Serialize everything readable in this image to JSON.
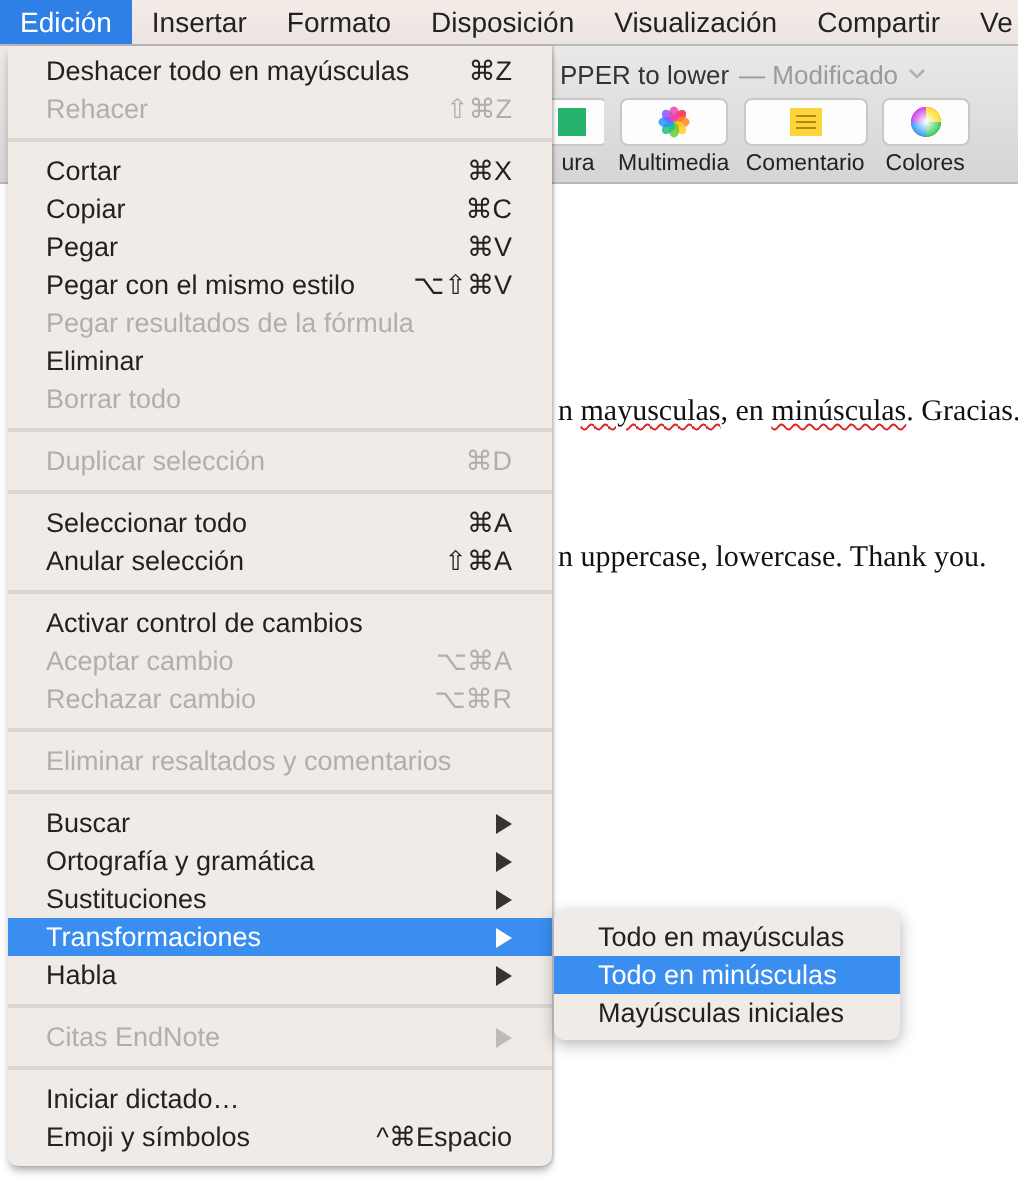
{
  "menubar": [
    {
      "label": "Edición",
      "selected": true
    },
    {
      "label": "Insertar",
      "selected": false
    },
    {
      "label": "Formato",
      "selected": false
    },
    {
      "label": "Disposición",
      "selected": false
    },
    {
      "label": "Visualización",
      "selected": false
    },
    {
      "label": "Compartir",
      "selected": false
    },
    {
      "label": "Ve",
      "selected": false
    }
  ],
  "window": {
    "title": "PPER to lower",
    "status": "— Modificado",
    "toolbar": [
      {
        "label": "ura",
        "kind": "shape"
      },
      {
        "label": "Multimedia",
        "kind": "media"
      },
      {
        "label": "Comentario",
        "kind": "comment"
      },
      {
        "label": "Colores",
        "kind": "colors"
      }
    ]
  },
  "document": {
    "paragraphs": [
      [
        {
          "text": "n ",
          "misspelled": false
        },
        {
          "text": "mayusculas",
          "misspelled": true
        },
        {
          "text": ", en ",
          "misspelled": false
        },
        {
          "text": "minúsculas",
          "misspelled": true
        },
        {
          "text": ". Gracias.",
          "misspelled": false
        }
      ],
      [
        {
          "text": "n uppercase, lowercase. Thank you.",
          "misspelled": false
        }
      ]
    ]
  },
  "menu": [
    {
      "kind": "item",
      "label": "Deshacer todo en mayúsculas",
      "shortcut": "⌘Z",
      "disabled": false,
      "submenu": false,
      "selected": false
    },
    {
      "kind": "item",
      "label": "Rehacer",
      "shortcut": "⇧⌘Z",
      "disabled": true,
      "submenu": false,
      "selected": false
    },
    {
      "kind": "separator"
    },
    {
      "kind": "item",
      "label": "Cortar",
      "shortcut": "⌘X",
      "disabled": false,
      "submenu": false,
      "selected": false
    },
    {
      "kind": "item",
      "label": "Copiar",
      "shortcut": "⌘C",
      "disabled": false,
      "submenu": false,
      "selected": false
    },
    {
      "kind": "item",
      "label": "Pegar",
      "shortcut": "⌘V",
      "disabled": false,
      "submenu": false,
      "selected": false
    },
    {
      "kind": "item",
      "label": "Pegar con el mismo estilo",
      "shortcut": "⌥⇧⌘V",
      "disabled": false,
      "submenu": false,
      "selected": false
    },
    {
      "kind": "item",
      "label": "Pegar resultados de la fórmula",
      "disabled": true,
      "submenu": false,
      "selected": false
    },
    {
      "kind": "item",
      "label": "Eliminar",
      "disabled": false,
      "submenu": false,
      "selected": false
    },
    {
      "kind": "item",
      "label": "Borrar todo",
      "disabled": true,
      "submenu": false,
      "selected": false
    },
    {
      "kind": "separator"
    },
    {
      "kind": "item",
      "label": "Duplicar selección",
      "shortcut": "⌘D",
      "disabled": true,
      "submenu": false,
      "selected": false
    },
    {
      "kind": "separator"
    },
    {
      "kind": "item",
      "label": "Seleccionar todo",
      "shortcut": "⌘A",
      "disabled": false,
      "submenu": false,
      "selected": false
    },
    {
      "kind": "item",
      "label": "Anular selección",
      "shortcut": "⇧⌘A",
      "disabled": false,
      "submenu": false,
      "selected": false
    },
    {
      "kind": "separator"
    },
    {
      "kind": "item",
      "label": "Activar control de cambios",
      "disabled": false,
      "submenu": false,
      "selected": false
    },
    {
      "kind": "item",
      "label": "Aceptar cambio",
      "shortcut": "⌥⌘A",
      "disabled": true,
      "submenu": false,
      "selected": false
    },
    {
      "kind": "item",
      "label": "Rechazar cambio",
      "shortcut": "⌥⌘R",
      "disabled": true,
      "submenu": false,
      "selected": false
    },
    {
      "kind": "separator"
    },
    {
      "kind": "item",
      "label": "Eliminar resaltados y comentarios",
      "disabled": true,
      "submenu": false,
      "selected": false
    },
    {
      "kind": "separator"
    },
    {
      "kind": "item",
      "label": "Buscar",
      "disabled": false,
      "submenu": true,
      "selected": false
    },
    {
      "kind": "item",
      "label": "Ortografía y gramática",
      "disabled": false,
      "submenu": true,
      "selected": false
    },
    {
      "kind": "item",
      "label": "Sustituciones",
      "disabled": false,
      "submenu": true,
      "selected": false
    },
    {
      "kind": "item",
      "label": "Transformaciones",
      "disabled": false,
      "submenu": true,
      "selected": true
    },
    {
      "kind": "item",
      "label": "Habla",
      "disabled": false,
      "submenu": true,
      "selected": false
    },
    {
      "kind": "separator"
    },
    {
      "kind": "item",
      "label": "Citas EndNote",
      "disabled": true,
      "submenu": true,
      "selected": false
    },
    {
      "kind": "separator"
    },
    {
      "kind": "item",
      "label": "Iniciar dictado…",
      "disabled": false,
      "submenu": false,
      "selected": false
    },
    {
      "kind": "item",
      "label": "Emoji y símbolos",
      "shortcut": "^⌘Espacio",
      "disabled": false,
      "submenu": false,
      "selected": false
    }
  ],
  "submenu": [
    {
      "label": "Todo en mayúsculas",
      "selected": false
    },
    {
      "label": "Todo en minúsculas",
      "selected": true
    },
    {
      "label": "Mayúsculas iniciales",
      "selected": false
    }
  ]
}
